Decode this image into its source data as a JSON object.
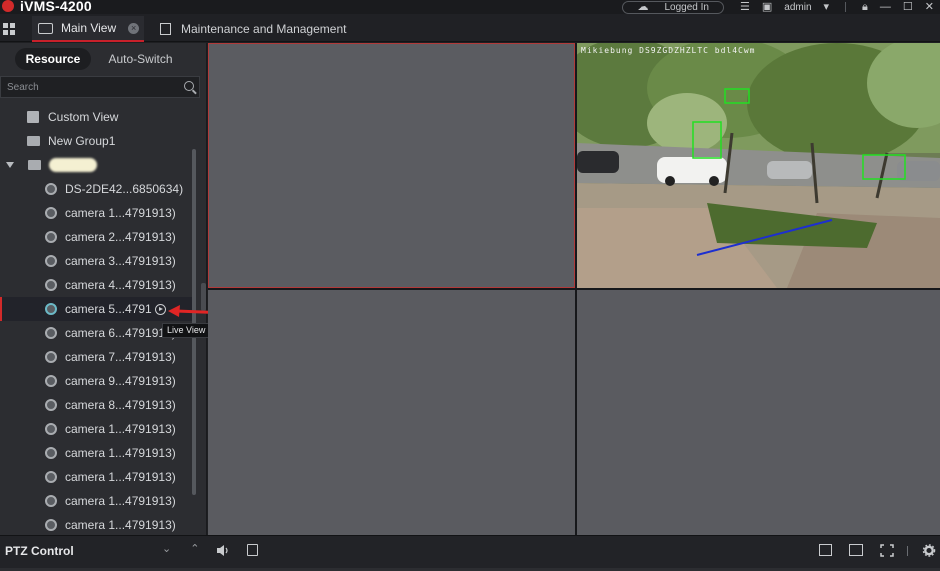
{
  "app": {
    "title": "iVMS-4200"
  },
  "window": {
    "status": "Logged In",
    "user": "admin"
  },
  "tabs": [
    {
      "label": "Main View",
      "active": true
    },
    {
      "label": "Maintenance and Management",
      "active": false
    }
  ],
  "sidebar": {
    "segments": [
      "Resource",
      "Auto-Switch"
    ],
    "search_placeholder": "Search",
    "tree": {
      "custom_view": "Custom View",
      "new_group": "New Group1",
      "devices": [
        "DS-2DE42...6850634)",
        "camera 1...4791913)",
        "camera 2...4791913)",
        "camera 3...4791913)",
        "camera 4...4791913)",
        "camera 5...4791",
        "camera 6...4791913)",
        "camera 7...4791913)",
        "camera 9...4791913)",
        "camera 8...4791913)",
        "camera 1...4791913)",
        "camera 1...4791913)",
        "camera 1...4791913)",
        "camera 1...4791913)",
        "camera 1...4791913)"
      ]
    },
    "tooltip": "Live View"
  },
  "live": {
    "osd_text": "Mikiebung DS9ZGDZHZLTC bdl4Cwm"
  },
  "bottom": {
    "ptz_label": "PTZ Control"
  },
  "colors": {
    "accent": "#c8202a",
    "selected_border": "#b23a3a"
  }
}
